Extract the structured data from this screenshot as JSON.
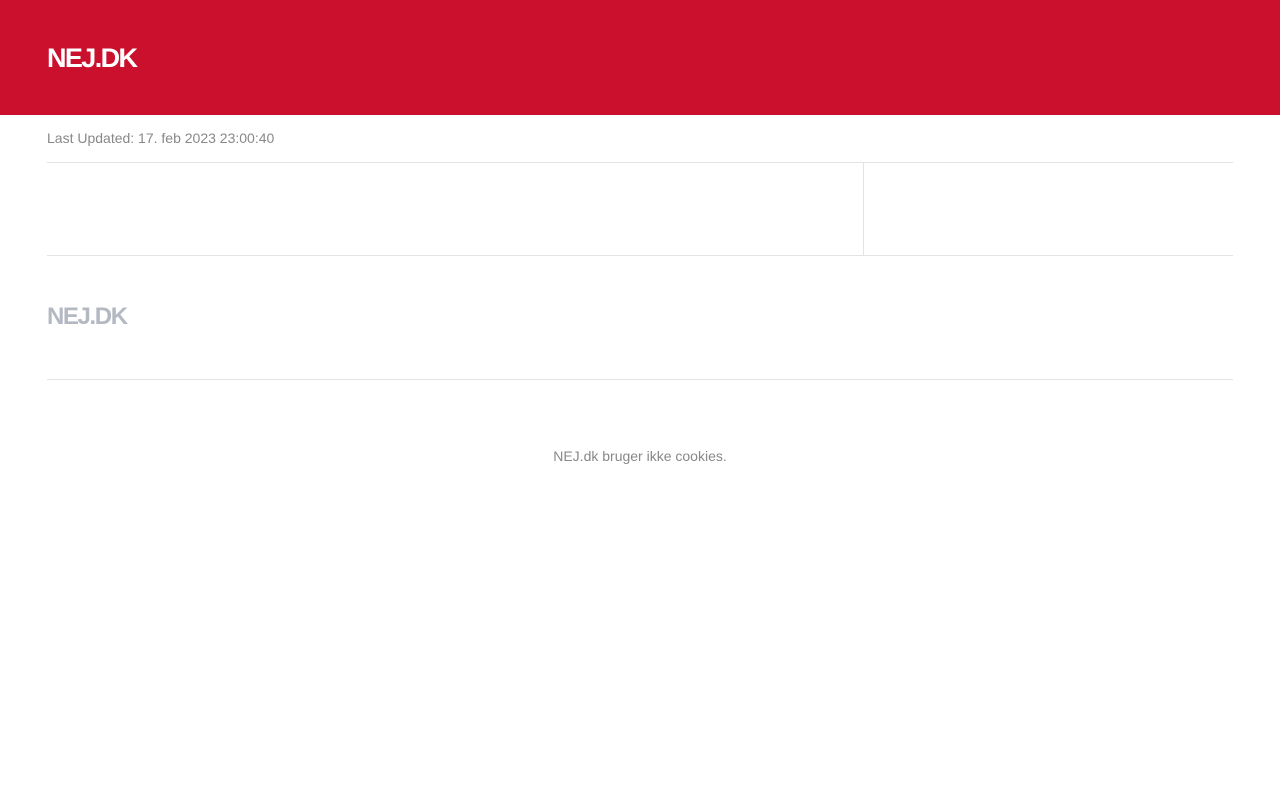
{
  "header": {
    "logo": "NEJ.DK",
    "background_color": "#ca102d"
  },
  "status": {
    "last_updated": "Last Updated: 17. feb 2023 23:00:40"
  },
  "footer": {
    "logo": "NEJ.DK",
    "cookie_note": "NEJ.dk bruger ikke cookies."
  }
}
